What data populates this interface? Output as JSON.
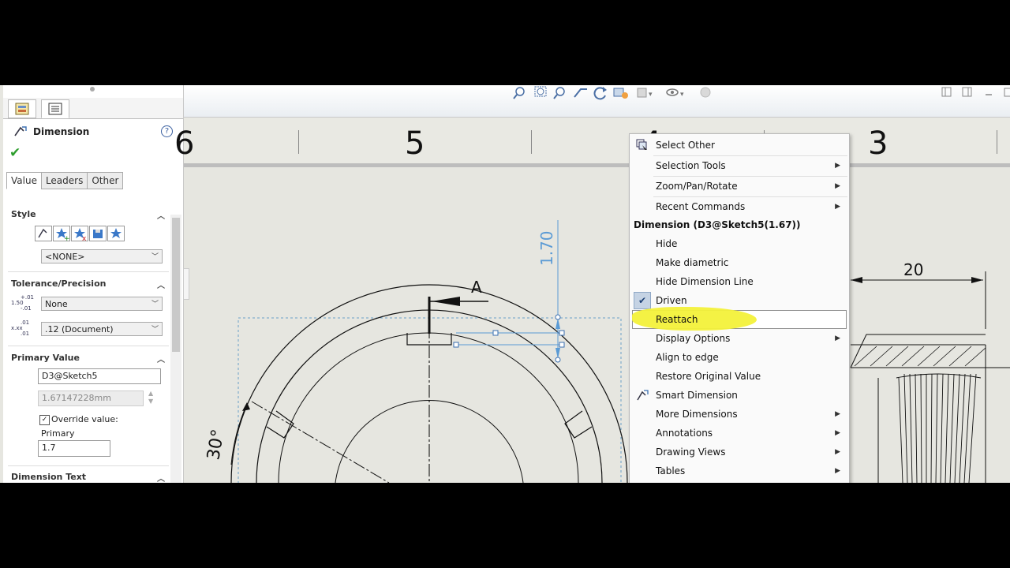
{
  "property_manager": {
    "title": "Dimension",
    "help": "?",
    "ok": "✔",
    "tabs": [
      "Value",
      "Leaders",
      "Other"
    ],
    "style": {
      "label": "Style",
      "select": "<NONE>"
    },
    "tolerance": {
      "label": "Tolerance/Precision",
      "tolerance_select": "None",
      "tol_icon_top": "+.01",
      "tol_icon_mid": "1.50",
      "tol_icon_bot": "-.01",
      "precision_select": ".12 (Document)",
      "prec_icon_top": ".01",
      "prec_icon_mid": "x.xx",
      "prec_icon_bot": ".01"
    },
    "primary_value": {
      "label": "Primary Value",
      "name": "D3@Sketch5",
      "value": "1.67147228mm",
      "override_label": "Override value:",
      "override_checked": true,
      "primary_label": "Primary",
      "primary_value": "1.7"
    },
    "dimension_text": {
      "label": "Dimension Text"
    }
  },
  "drawing": {
    "zones": [
      "6",
      "5",
      "4",
      "3"
    ],
    "vertical_dim": "1.70",
    "section_label": "A",
    "angle_dim": "30°",
    "horizontal_dim": "20"
  },
  "context_menu": {
    "items_top": [
      {
        "label": "Select Other",
        "icon": "select-other-icon",
        "submenu": false
      },
      {
        "label": "Selection Tools",
        "submenu": true
      },
      {
        "label": "Zoom/Pan/Rotate",
        "submenu": true
      },
      {
        "label": "Recent Commands",
        "submenu": true
      }
    ],
    "header": "Dimension (D3@Sketch5(1.67))",
    "items_bottom": [
      {
        "label": "Hide",
        "submenu": false
      },
      {
        "label": "Make diametric",
        "submenu": false
      },
      {
        "label": "Hide Dimension Line",
        "submenu": false
      },
      {
        "label": "Driven",
        "checked": true,
        "submenu": false
      },
      {
        "label": "Reattach",
        "highlighted": true,
        "submenu": false
      },
      {
        "label": "Display Options",
        "submenu": true
      },
      {
        "label": "Align to edge",
        "submenu": false
      },
      {
        "label": "Restore Original Value",
        "submenu": false
      },
      {
        "label": "Smart Dimension",
        "icon": "smart-dimension-icon",
        "submenu": false
      },
      {
        "label": "More Dimensions",
        "submenu": true
      },
      {
        "label": "Annotations",
        "submenu": true
      },
      {
        "label": "Drawing Views",
        "submenu": true
      },
      {
        "label": "Tables",
        "submenu": true
      }
    ]
  },
  "colors": {
    "highlight": "#f3f13a",
    "dimension_blue": "#5b9bd5",
    "accept_green": "#2e9e2e"
  }
}
